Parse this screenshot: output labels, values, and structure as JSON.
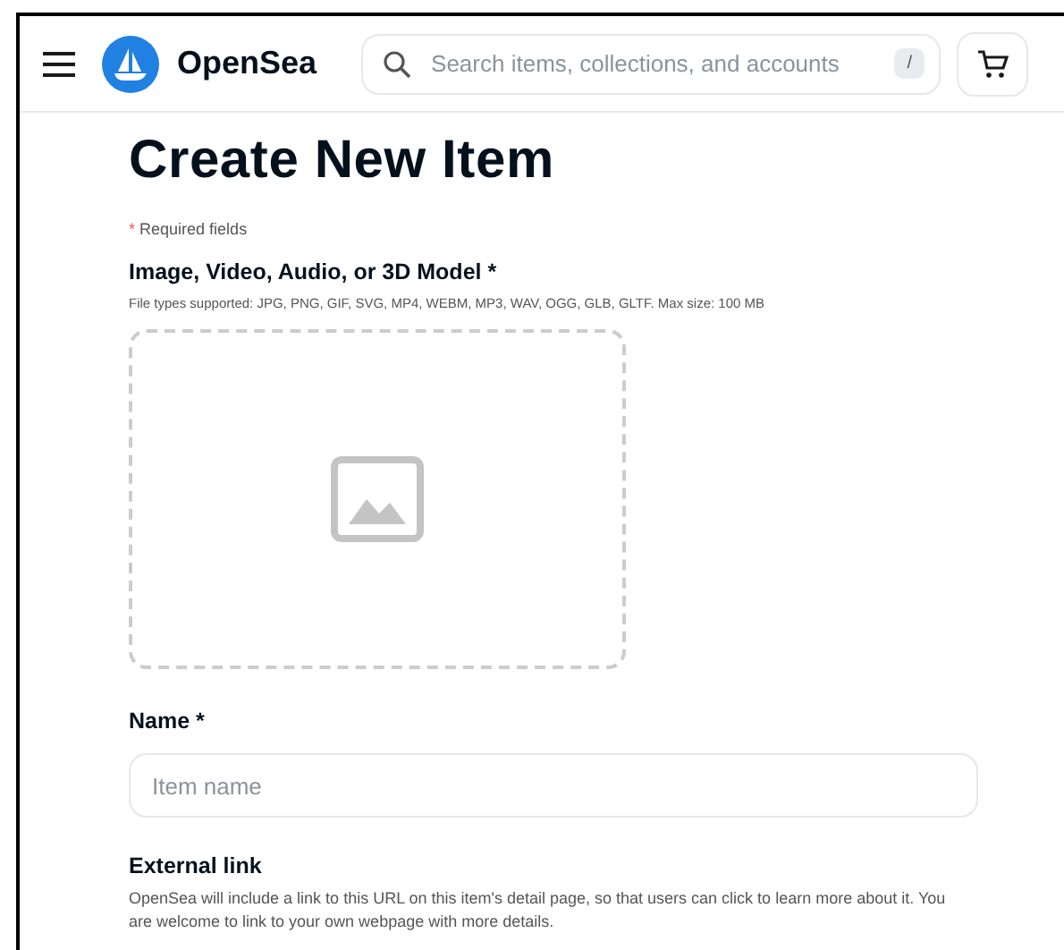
{
  "header": {
    "logo_text": "OpenSea",
    "search": {
      "placeholder": "Search items, collections, and accounts",
      "shortcut": "/"
    }
  },
  "page": {
    "title": "Create New Item",
    "required_note": {
      "mark": "*",
      "text": "Required fields"
    },
    "media": {
      "label": "Image, Video, Audio, or 3D Model *",
      "hint": "File types supported: JPG, PNG, GIF, SVG, MP4, WEBM, MP3, WAV, OGG, GLB, GLTF. Max size: 100 MB"
    },
    "name": {
      "label": "Name *",
      "placeholder": "Item name"
    },
    "external_link": {
      "label": "External link",
      "description": "OpenSea will include a link to this URL on this item's detail page, so that users can click to learn more about it. You are welcome to link to your own webpage with more details."
    }
  }
}
